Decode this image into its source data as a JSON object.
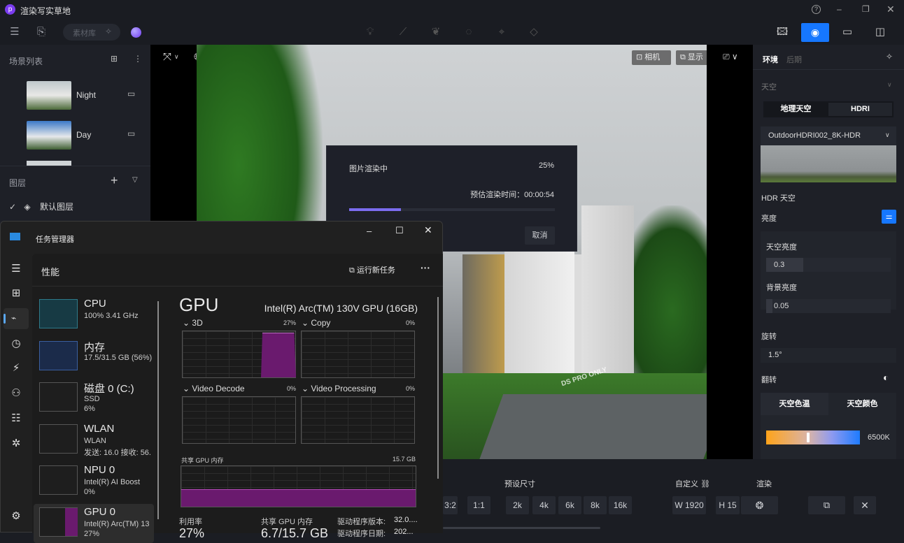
{
  "app": {
    "title": "渲染写实草地",
    "logo_letter": "p"
  },
  "window_controls": {
    "help": "?",
    "minimize": "–",
    "restore": "❐",
    "close": "✕"
  },
  "toolbar": {
    "menu_icon": "menu-icon",
    "import_icon": "file-import-icon",
    "search_placeholder": "素材库",
    "center_icons": [
      "light-bulb-icon",
      "path-icon",
      "leaf-icon",
      "fire-icon",
      "pin-icon",
      "landscape-icon"
    ],
    "right_modes": [
      "ai-image-icon",
      "camera-icon",
      "video-icon",
      "gallery-icon"
    ],
    "active_mode": "camera-icon"
  },
  "scenes": {
    "title": "场景列表",
    "items": [
      {
        "name": "Night"
      },
      {
        "name": "Day"
      }
    ]
  },
  "layers": {
    "title": "图层",
    "items": [
      {
        "name": "默认图层",
        "checked": true
      }
    ]
  },
  "viewport": {
    "camera_label": "相机",
    "display_label": "显示",
    "watermark": "DS PRO ONLY"
  },
  "render_dialog": {
    "title": "图片渲染中",
    "percent": "25%",
    "progress": 0.25,
    "eta": "预估渲染时间：00:00:54",
    "cancel": "取消",
    "accent": "#7b6cf0"
  },
  "right_panel": {
    "tabs": [
      "环境",
      "后期"
    ],
    "active_tab": "环境",
    "section": "天空",
    "sky_tabs": [
      "地理天空",
      "HDRI"
    ],
    "active_sky_tab": "地理天空",
    "hdri_select": "OutdoorHDRI002_8K-HDR",
    "hdr_label": "HDR 天空",
    "brightness_label": "亮度",
    "sky_brightness_label": "天空亮度",
    "sky_brightness": "0.3",
    "bg_brightness_label": "背景亮度",
    "bg_brightness": "0.05",
    "rotation_label": "旋转",
    "rotation": "1.5°",
    "flip_label": "翻转",
    "color_tabs": [
      "天空色温",
      "天空颜色"
    ],
    "active_color_tab": "天空色温",
    "temperature": "6500K",
    "accent": "#1677ff"
  },
  "bottom_bar": {
    "preset_label": "预设尺寸",
    "custom_label": "自定义",
    "render_label": "渲染",
    "ratios": [
      "3:2",
      "1:1"
    ],
    "sizes": [
      "2k",
      "4k",
      "6k",
      "8k",
      "16k"
    ],
    "width": "W  1920",
    "height": "H  15"
  },
  "task_manager": {
    "title": "任务管理器",
    "page": "性能",
    "run_task": "运行新任务",
    "more": "···",
    "devices": [
      {
        "name": "CPU",
        "line1": "100% 3.41 GHz",
        "line2": ""
      },
      {
        "name": "内存",
        "line1": "17.5/31.5 GB (56%)",
        "line2": ""
      },
      {
        "name": "磁盘 0 (C:)",
        "line1": "SSD",
        "line2": "6%"
      },
      {
        "name": "WLAN",
        "line1": "WLAN",
        "line2": "发送: 16.0 接收: 56."
      },
      {
        "name": "NPU 0",
        "line1": "Intel(R) AI Boost",
        "line2": "0%"
      },
      {
        "name": "GPU 0",
        "line1": "Intel(R) Arc(TM) 13",
        "line2": "27%"
      }
    ],
    "gpu": {
      "heading": "GPU",
      "model": "Intel(R) Arc(TM) 130V GPU (16GB)",
      "engines": [
        {
          "name": "3D",
          "value": "27%"
        },
        {
          "name": "Copy",
          "value": "0%"
        },
        {
          "name": "Video Decode",
          "value": "0%"
        },
        {
          "name": "Video Processing",
          "value": "0%"
        }
      ],
      "shared_mem_label": "共享 GPU 内存",
      "shared_mem_max": "15.7 GB",
      "stats": {
        "util_label": "利用率",
        "util": "27%",
        "shared_label": "共享 GPU 内存",
        "shared": "6.7/15.7 GB",
        "driver_ver_label": "驱动程序版本:",
        "driver_ver": "32.0....",
        "driver_date_label": "驱动程序日期:",
        "driver_date": "202..."
      }
    },
    "accent": "#8a2a8e"
  }
}
